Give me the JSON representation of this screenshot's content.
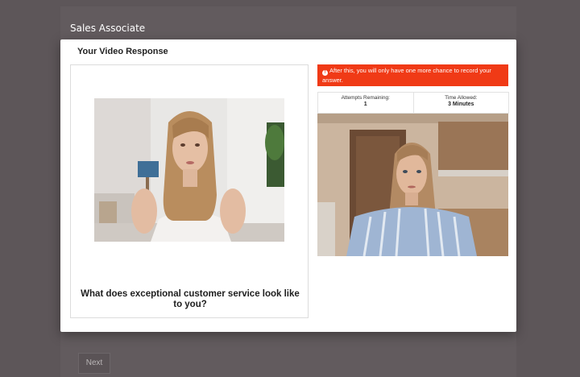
{
  "background": {
    "job_title": "Sales Associate",
    "next_label": "Next"
  },
  "modal": {
    "title": "Your Video Response",
    "question": "What does exceptional customer service look like to you?",
    "alert_text": "After this, you will only have one more chance to record your answer.",
    "attempts_label": "Attempts Remaining:",
    "attempts_value": "1",
    "time_label": "Time Allowed:",
    "time_value": "3 Minutes"
  },
  "colors": {
    "alert": "#f03a16",
    "overlay": "#5d5659"
  }
}
